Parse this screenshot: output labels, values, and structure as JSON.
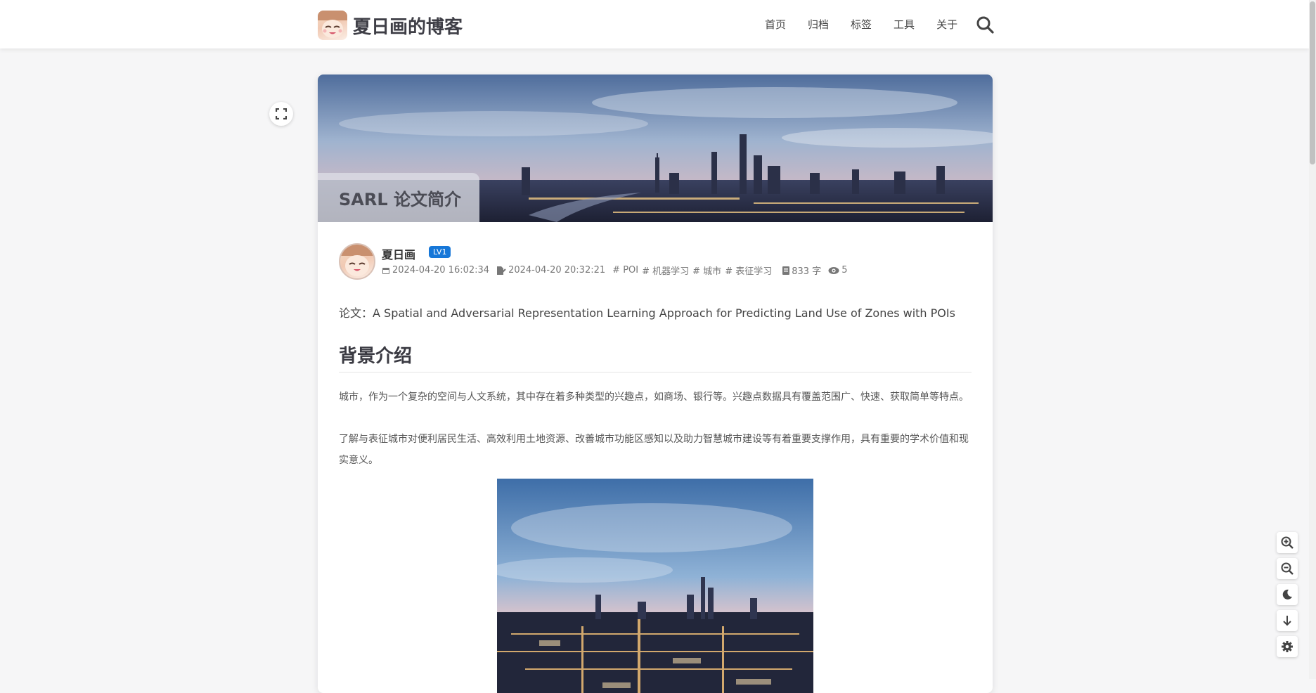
{
  "header": {
    "site_title": "夏日画的博客",
    "nav": [
      "首页",
      "归档",
      "标签",
      "工具",
      "关于"
    ]
  },
  "post": {
    "title": "SARL 论文简介",
    "author": "夏日画",
    "level_badge": "LV1",
    "created": "2024-04-20 16:02:34",
    "updated": "2024-04-20 20:32:21",
    "tags": [
      "POI",
      "机器学习",
      "城市",
      "表征学习"
    ],
    "word_count": "833 字",
    "views": "5",
    "paper_line": "论文：A Spatial and Adversarial Representation Learning Approach for Predicting Land Use of Zones with POIs",
    "section_heading": "背景介绍",
    "paragraph_1": "城市，作为一个复杂的空间与人文系统，其中存在着多种类型的兴趣点，如商场、银行等。兴趣点数据具有覆盖范围广、快速、获取简单等特点。",
    "paragraph_2": "了解与表征城市对便利居民生活、高效利用土地资源、改善城市功能区感知以及助力智慧城市建设等有着重要支撑作用，具有重要的学术价值和现实意义。"
  },
  "colors": {
    "accent": "#1677d8",
    "heading": "#3a3a42"
  },
  "icons": {
    "search": "search-icon",
    "fullscreen": "fullscreen-icon",
    "tools": [
      "zoom-in-icon",
      "zoom-out-icon",
      "moon-icon",
      "arrow-down-icon",
      "gear-icon"
    ]
  }
}
